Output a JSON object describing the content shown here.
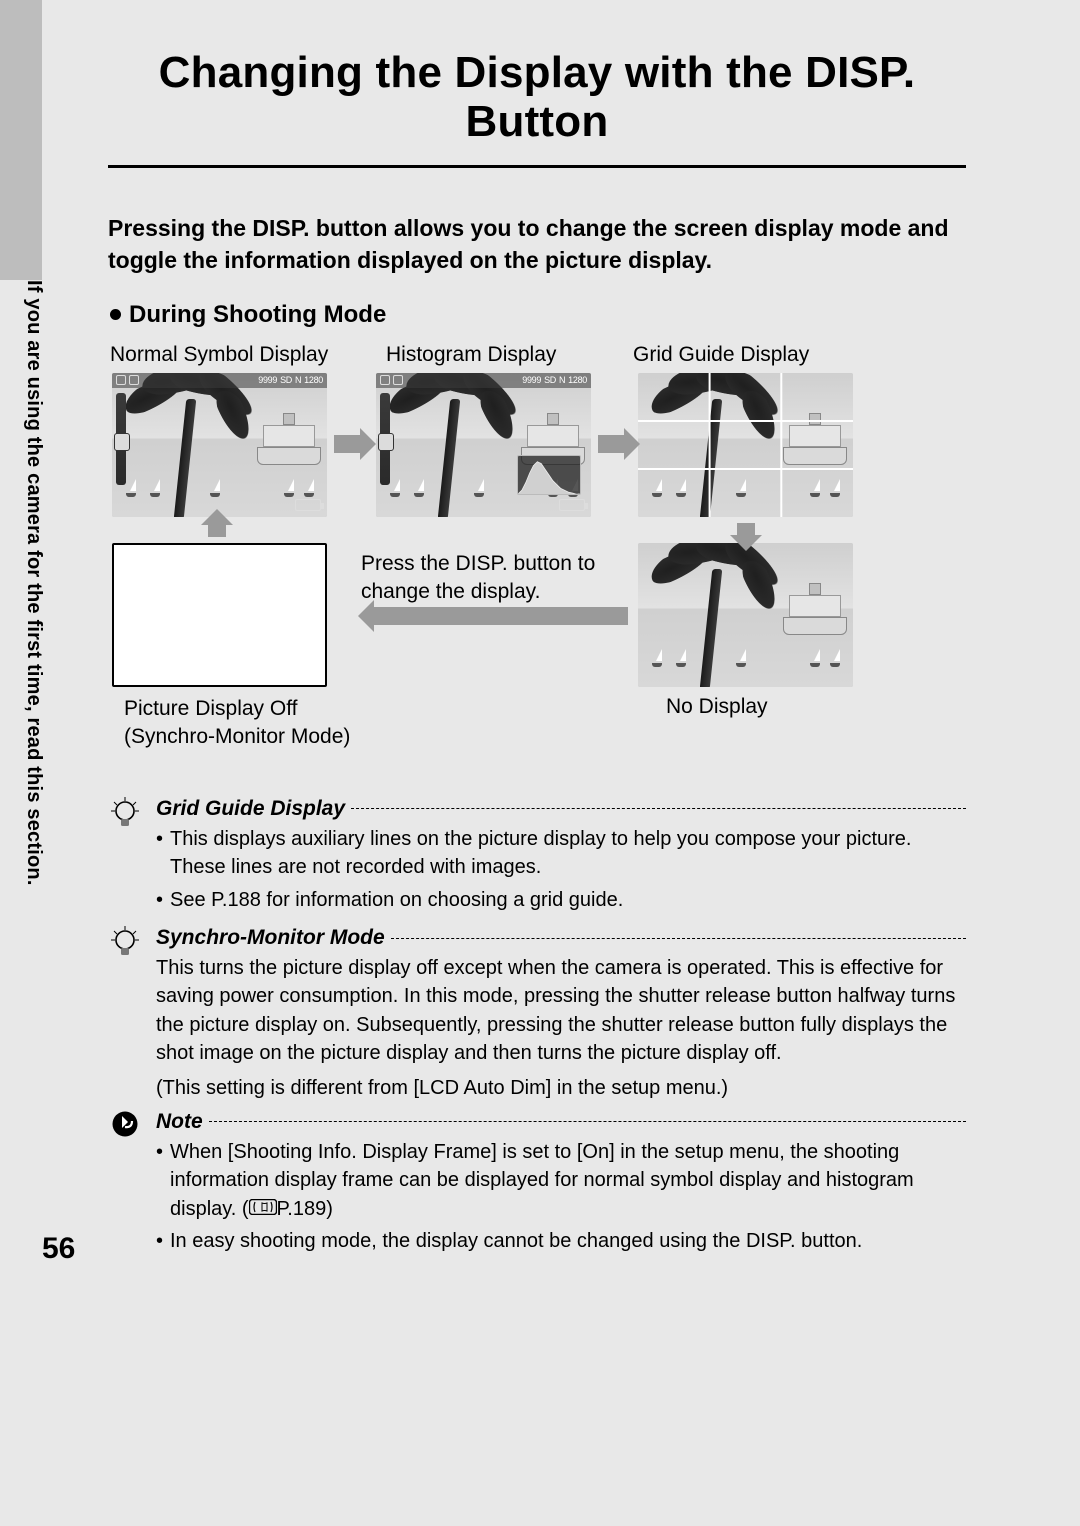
{
  "side_text": "If you are using the camera for the first time, read this section.",
  "page_title": "Changing the Display with the DISP. Button",
  "intro": "Pressing the DISP. button allows you to change the screen display mode and toggle the information displayed on the picture display.",
  "section_heading": "During Shooting Mode",
  "captions": {
    "normal": "Normal Symbol Display",
    "histogram": "Histogram Display",
    "grid": "Grid Guide Display",
    "off_line1": "Picture Display Off",
    "off_line2": "(Synchro-Monitor Mode)",
    "no_display": "No Display",
    "cycle_line1": "Press the DISP. button to",
    "cycle_line2": "change the display."
  },
  "osd": {
    "shots": "9999",
    "sd": "SD",
    "quality": "N",
    "size": "1280"
  },
  "tips": {
    "grid": {
      "title": "Grid Guide Display",
      "bullets": [
        "This displays auxiliary lines on the picture display to help you compose your picture. These lines are not recorded with images.",
        "See P.188 for information on choosing a grid guide."
      ]
    },
    "synchro": {
      "title": "Synchro-Monitor Mode",
      "para1": "This turns the picture display off except when the camera is operated. This is effective for saving power consumption. In this mode, pressing the shutter release button halfway turns the picture display on. Subsequently, pressing the shutter release button fully displays the shot image on the picture display and then turns the picture display off.",
      "para2": "(This setting is different from [LCD Auto Dim] in the setup menu.)"
    },
    "note": {
      "title": "Note",
      "bullets_pre": "When [Shooting Info. Display Frame] is set to [On] in the setup menu, the shooting information display frame can be displayed for normal symbol display and histogram display. (",
      "page_ref": "P.189)",
      "bullet2": "In easy shooting mode, the display cannot be changed using the DISP. button."
    }
  },
  "page_number": "56"
}
